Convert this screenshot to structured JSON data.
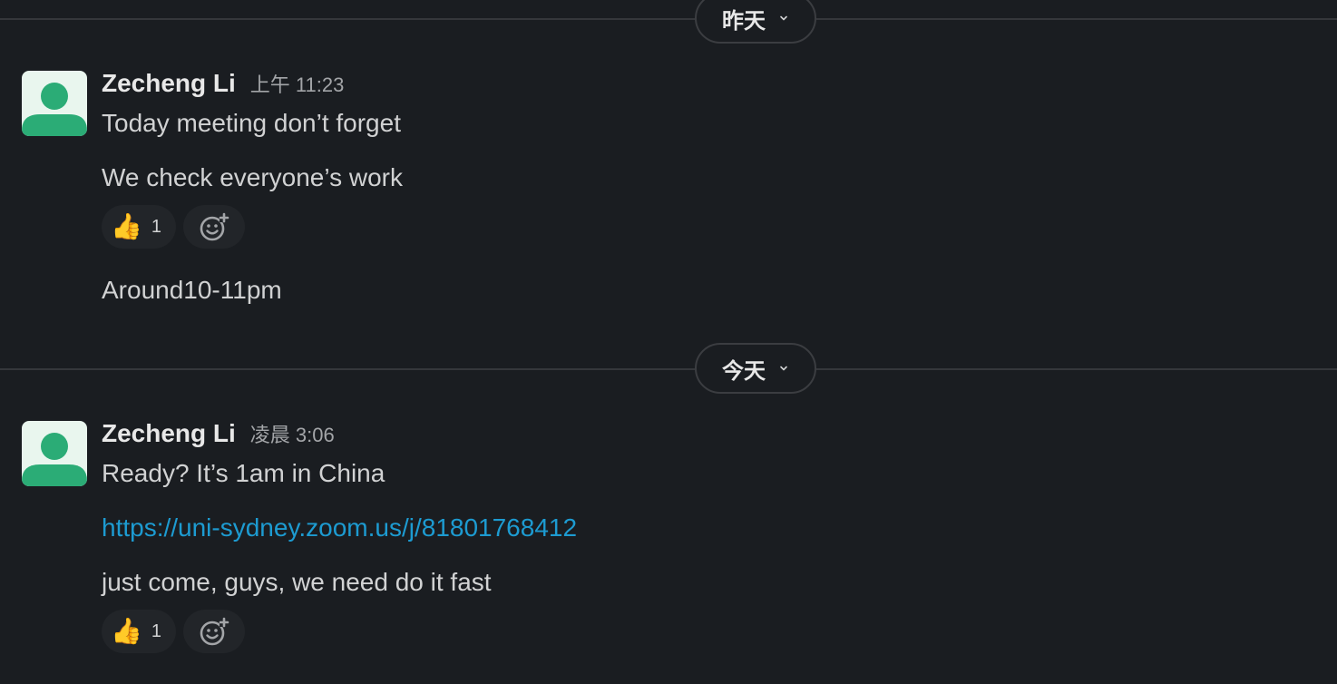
{
  "separators": [
    {
      "label": "昨天"
    },
    {
      "label": "今天"
    }
  ],
  "messages": [
    {
      "author": "Zecheng Li",
      "time": "上午 11:23",
      "lines": [
        "Today meeting don’t forget",
        "We check everyone’s work"
      ],
      "reaction": {
        "emoji": "👍",
        "count": "1"
      },
      "followup": "Around10-11pm"
    },
    {
      "author": "Zecheng Li",
      "time": "凌晨 3:06",
      "lines": [
        "Ready? It’s 1am in China"
      ],
      "link": "https://uni-sydney.zoom.us/j/81801768412",
      "followup": "just come, guys, we need do it fast",
      "reaction": {
        "emoji": "👍",
        "count": "1"
      }
    }
  ],
  "colors": {
    "background": "#1a1d21",
    "avatar_bg": "#e9f6ee",
    "avatar_fg": "#2bac76",
    "link": "#1d9bd1"
  },
  "icons": {
    "date_chevron": "chevron-down-icon",
    "add_reaction": "add-reaction-icon",
    "avatar": "user-avatar-icon"
  }
}
